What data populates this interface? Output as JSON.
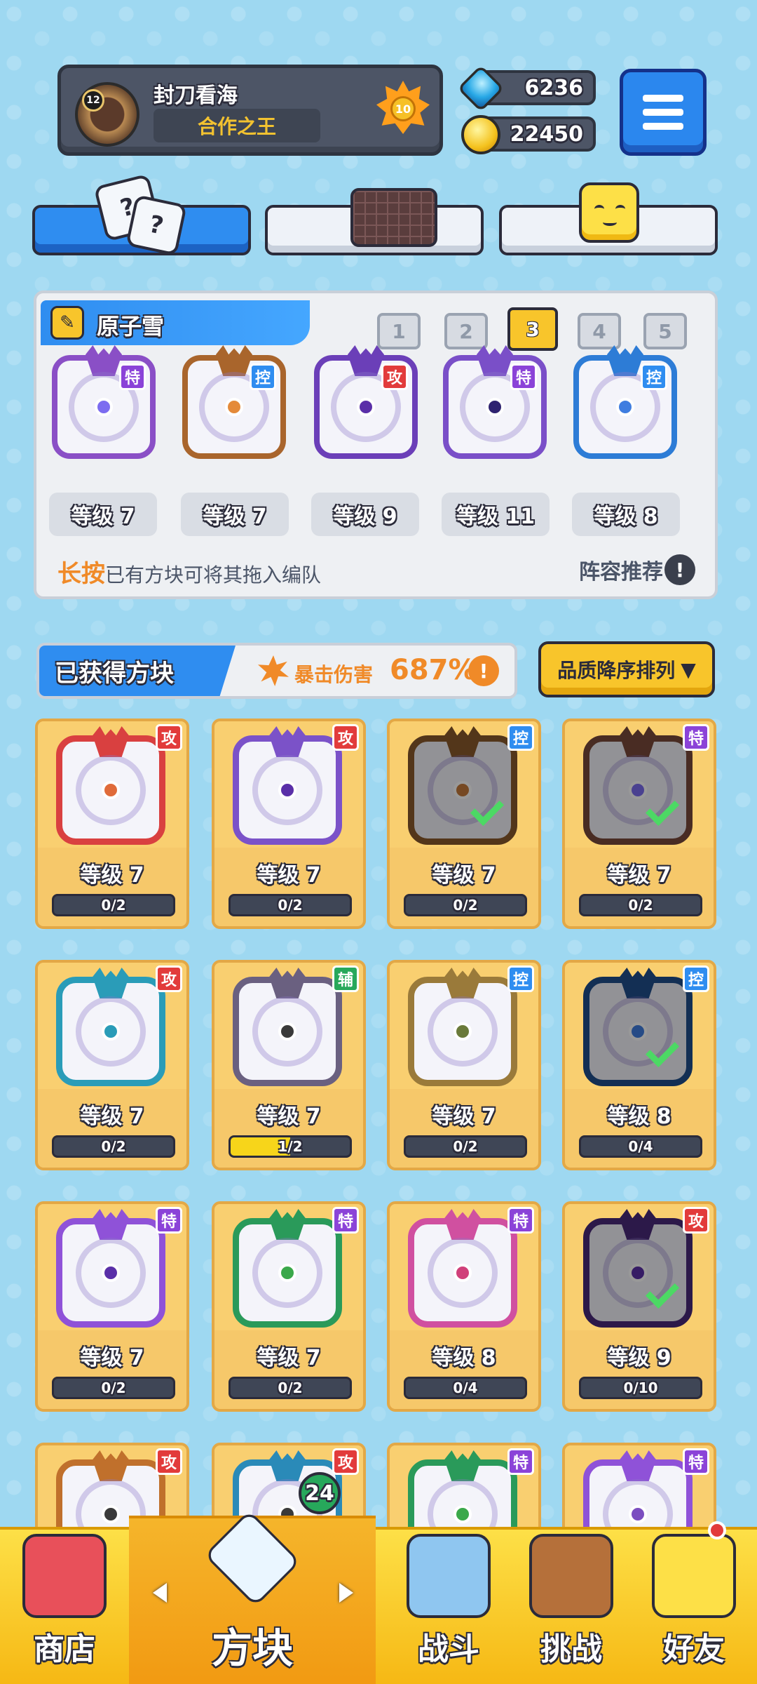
{
  "header": {
    "player_name": "封刀看海",
    "player_title": "合作之王",
    "avatar_level": "12",
    "rank_level": "10",
    "gems": "6236",
    "coins": "22450"
  },
  "deck": {
    "name": "原子雪",
    "slots": [
      "1",
      "2",
      "3",
      "4",
      "5"
    ],
    "active_slot": 3,
    "cards": [
      {
        "tag": "特",
        "tag_type": "spc",
        "level": "等级 7",
        "color": "#8a4fc6",
        "accent": "#7c6cf0"
      },
      {
        "tag": "控",
        "tag_type": "ctl",
        "level": "等级 7",
        "color": "#a9652c",
        "accent": "#e48a3a"
      },
      {
        "tag": "攻",
        "tag_type": "atk",
        "level": "等级 9",
        "color": "#6b3fb8",
        "accent": "#5a2fa8"
      },
      {
        "tag": "特",
        "tag_type": "spc",
        "level": "等级 11",
        "color": "#7a4fc8",
        "accent": "#2e2270"
      },
      {
        "tag": "控",
        "tag_type": "ctl",
        "level": "等级 8",
        "color": "#2d7cd6",
        "accent": "#3f7de0"
      }
    ],
    "hint_em": "长按",
    "hint_rest": "已有方块可将其拖入编队",
    "recommend": "阵容推荐"
  },
  "owned": {
    "label": "已获得方块",
    "crit_label": "暴击伤害",
    "crit_value": "687%",
    "sort_label": "品质降序排列",
    "blocks": [
      {
        "tag": "攻",
        "tag_type": "atk",
        "level": "等级 7",
        "progress": "0/2",
        "fill": 0,
        "color": "#d94040",
        "accent": "#e06b3a",
        "in_deck": false
      },
      {
        "tag": "攻",
        "tag_type": "atk",
        "level": "等级 7",
        "progress": "0/2",
        "fill": 0,
        "color": "#7b52c8",
        "accent": "#5a2fa8",
        "in_deck": false
      },
      {
        "tag": "控",
        "tag_type": "ctl",
        "level": "等级 7",
        "progress": "0/2",
        "fill": 0,
        "color": "#8a5a2c",
        "accent": "#c47a3a",
        "in_deck": true
      },
      {
        "tag": "特",
        "tag_type": "spc",
        "level": "等级 7",
        "progress": "0/2",
        "fill": 0,
        "color": "#7a4a3a",
        "accent": "#7c6cf0",
        "in_deck": true
      },
      {
        "tag": "攻",
        "tag_type": "atk",
        "level": "等级 7",
        "progress": "0/2",
        "fill": 0,
        "color": "#2a9cb8",
        "accent": "#2a9cb8",
        "in_deck": false
      },
      {
        "tag": "辅",
        "tag_type": "sup",
        "level": "等级 7",
        "progress": "1/2",
        "fill": 0.5,
        "color": "#6a6080",
        "accent": "#3a3a3a",
        "in_deck": false
      },
      {
        "tag": "控",
        "tag_type": "ctl",
        "level": "等级 7",
        "progress": "0/2",
        "fill": 0,
        "color": "#9a7a3a",
        "accent": "#6a7a3a",
        "in_deck": false
      },
      {
        "tag": "控",
        "tag_type": "ctl",
        "level": "等级 8",
        "progress": "0/4",
        "fill": 0,
        "color": "#1f4f8c",
        "accent": "#3f7de0",
        "in_deck": true
      },
      {
        "tag": "特",
        "tag_type": "spc",
        "level": "等级 7",
        "progress": "0/2",
        "fill": 0,
        "color": "#8f52d8",
        "accent": "#5a2fa8",
        "in_deck": false
      },
      {
        "tag": "特",
        "tag_type": "spc",
        "level": "等级 7",
        "progress": "0/2",
        "fill": 0,
        "color": "#2a9a5a",
        "accent": "#3aa84a",
        "in_deck": false
      },
      {
        "tag": "特",
        "tag_type": "spc",
        "level": "等级 8",
        "progress": "0/4",
        "fill": 0,
        "color": "#d050a0",
        "accent": "#d0407a",
        "in_deck": false
      },
      {
        "tag": "攻",
        "tag_type": "atk",
        "level": "等级 9",
        "progress": "0/10",
        "fill": 0,
        "color": "#4a2a7a",
        "accent": "#5a2fa8",
        "in_deck": true
      },
      {
        "tag": "攻",
        "tag_type": "atk",
        "level": "",
        "progress": "",
        "fill": 0,
        "color": "#c0702c",
        "accent": "#3a3a3a",
        "in_deck": false
      },
      {
        "tag": "攻",
        "tag_type": "atk",
        "level": "",
        "progress": "",
        "fill": 0,
        "color": "#2a8ab8",
        "accent": "#3a3a3a",
        "in_deck": false
      },
      {
        "tag": "特",
        "tag_type": "spc",
        "level": "",
        "progress": "",
        "fill": 0,
        "color": "#2a9a5a",
        "accent": "#3aa84a",
        "in_deck": false
      },
      {
        "tag": "特",
        "tag_type": "spc",
        "level": "",
        "progress": "",
        "fill": 0,
        "color": "#8f52d8",
        "accent": "#7b4ec0",
        "in_deck": false
      }
    ]
  },
  "nav": {
    "shop": "商店",
    "blocks": "方块",
    "battle": "战斗",
    "challenge": "挑战",
    "friends": "好友",
    "new_count": "24"
  },
  "colors": {
    "primary_blue": "#2f8df0",
    "gold": "#f8c52b",
    "attack_red": "#e23b3b",
    "control_blue": "#2f8df0",
    "special_purple": "#8b43d8",
    "support_green": "#27a85b"
  }
}
